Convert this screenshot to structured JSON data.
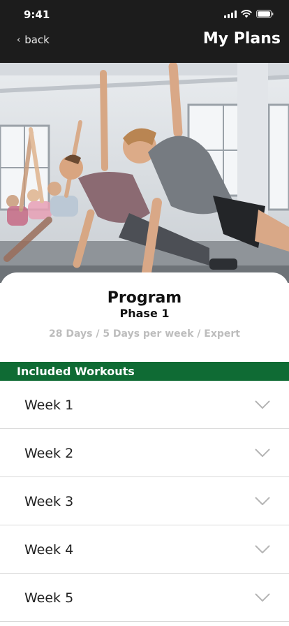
{
  "status": {
    "time": "9:41"
  },
  "nav": {
    "back_label": "back",
    "title": "My Plans"
  },
  "program": {
    "title": "Program",
    "phase": "Phase 1",
    "meta": "28 Days / 5 Days per week / Expert"
  },
  "section": {
    "title": "Included Workouts"
  },
  "weeks": [
    {
      "label": "Week 1"
    },
    {
      "label": "Week 2"
    },
    {
      "label": "Week 3"
    },
    {
      "label": "Week 4"
    },
    {
      "label": "Week 5"
    }
  ],
  "colors": {
    "header_bg": "#1c1c1c",
    "accent_green": "#0f6b34",
    "meta_gray": "#bdbdbd"
  },
  "icons": {
    "back": "chevron-left-icon",
    "expand": "chevron-down-icon",
    "signal": "signal-icon",
    "wifi": "wifi-icon",
    "battery": "battery-icon"
  }
}
